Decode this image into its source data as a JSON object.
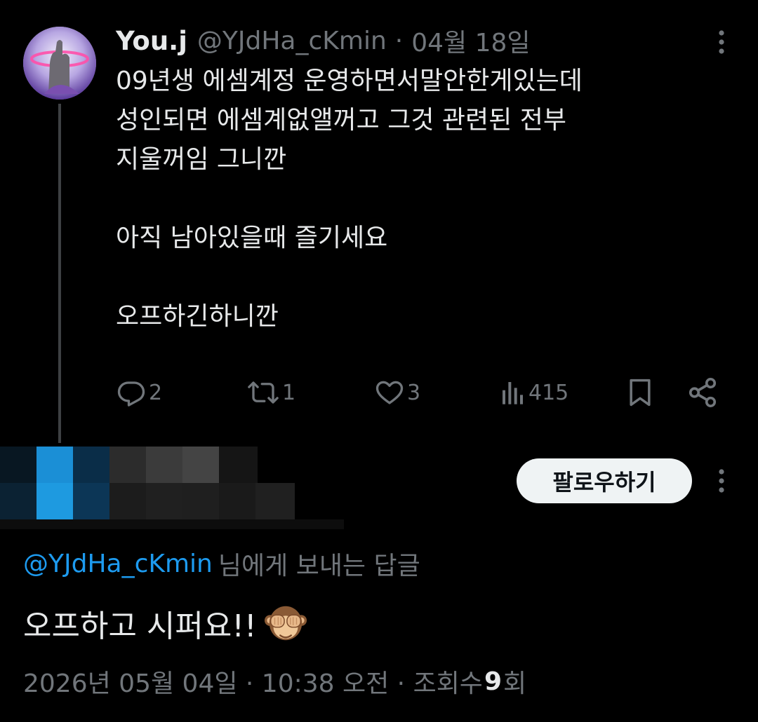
{
  "tweet": {
    "display_name": "You.j",
    "handle": "@YJdHa_cKmin",
    "separator": "·",
    "date": "04월 18일",
    "lines": [
      "09년생 에셈계정 운영하면서말안한게있는데",
      "성인되면 에셈계없앨꺼고 그것 관련된 전부",
      "지울꺼임 그니깐",
      "",
      "아직 남아있을때 즐기세요",
      "",
      "오프하긴하니깐"
    ],
    "stats": {
      "replies": "2",
      "retweets": "1",
      "likes": "3",
      "views": "415"
    },
    "icons": {
      "more": "more-vertical-icon",
      "reply": "reply-icon",
      "retweet": "retweet-icon",
      "like": "heart-icon",
      "views": "views-icon",
      "bookmark": "bookmark-icon",
      "share": "share-icon"
    }
  },
  "reply": {
    "follow_label": "팔로우하기",
    "replying_to_handle": "@YJdHa_cKmin",
    "replying_to_suffix": "님에게 보내는 답글",
    "text": "오프하고 시퍼요!!",
    "emoji": "see-no-evil-monkey-icon",
    "meta_date": "2026년 05월 04일 · 10:38 오전 · 조회수 ",
    "meta_views": "9",
    "meta_suffix": "회"
  },
  "colors": {
    "background": "#000000",
    "text_primary": "#e7e9ea",
    "text_secondary": "#71767b",
    "link": "#1d9bf0",
    "button_bg": "#eff3f4",
    "button_text": "#0f1419"
  }
}
